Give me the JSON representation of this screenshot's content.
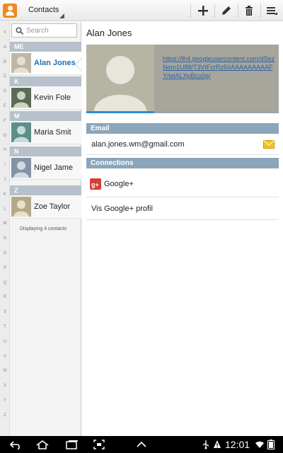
{
  "actionbar": {
    "title": "Contacts",
    "icons": [
      "contacts-app-icon",
      "add-icon",
      "edit-icon",
      "delete-icon",
      "menu-icon"
    ]
  },
  "index_letters": [
    "#",
    "A",
    "B",
    "C",
    "D",
    "E",
    "F",
    "G",
    "H",
    "I",
    "J",
    "K",
    "L",
    "M",
    "N",
    "O",
    "P",
    "Q",
    "R",
    "S",
    "T",
    "U",
    "V",
    "W",
    "X",
    "Y",
    "Z"
  ],
  "list": {
    "search_placeholder": "Search",
    "sections": [
      {
        "header": "ME",
        "name": "Alan Jones",
        "selected": true
      },
      {
        "header": "K",
        "name": "Kevin Fole",
        "selected": false
      },
      {
        "header": "M",
        "name": "Maria Smit",
        "selected": false
      },
      {
        "header": "N",
        "name": "Nigel Jame",
        "selected": false
      },
      {
        "header": "Z",
        "name": "Zoe Taylor",
        "selected": false
      }
    ],
    "count_text": "Displaying 4 contacts"
  },
  "detail": {
    "name": "Alan Jones",
    "photo_link": "https://lh4.googleusercontent.com/dSezNom1U88/T3VtFcrRz5I/AAAAAAAAAFY/wIALXpBcu0g/",
    "email_header": "Email",
    "email": "alan.jones.wm@gmail.com",
    "connections_header": "Connections",
    "connections": [
      {
        "label": "Google+"
      },
      {
        "label": "Vis Google+ profil"
      }
    ]
  },
  "statusbar": {
    "time": "12:01"
  },
  "colors": {
    "accent": "#2f8bd6",
    "section_header": "#8ba5bb",
    "list_header": "#b7c1cb",
    "selected_text": "#1e6fb0",
    "google_plus": "#d73d32",
    "email_icon": "#f4c21a"
  }
}
